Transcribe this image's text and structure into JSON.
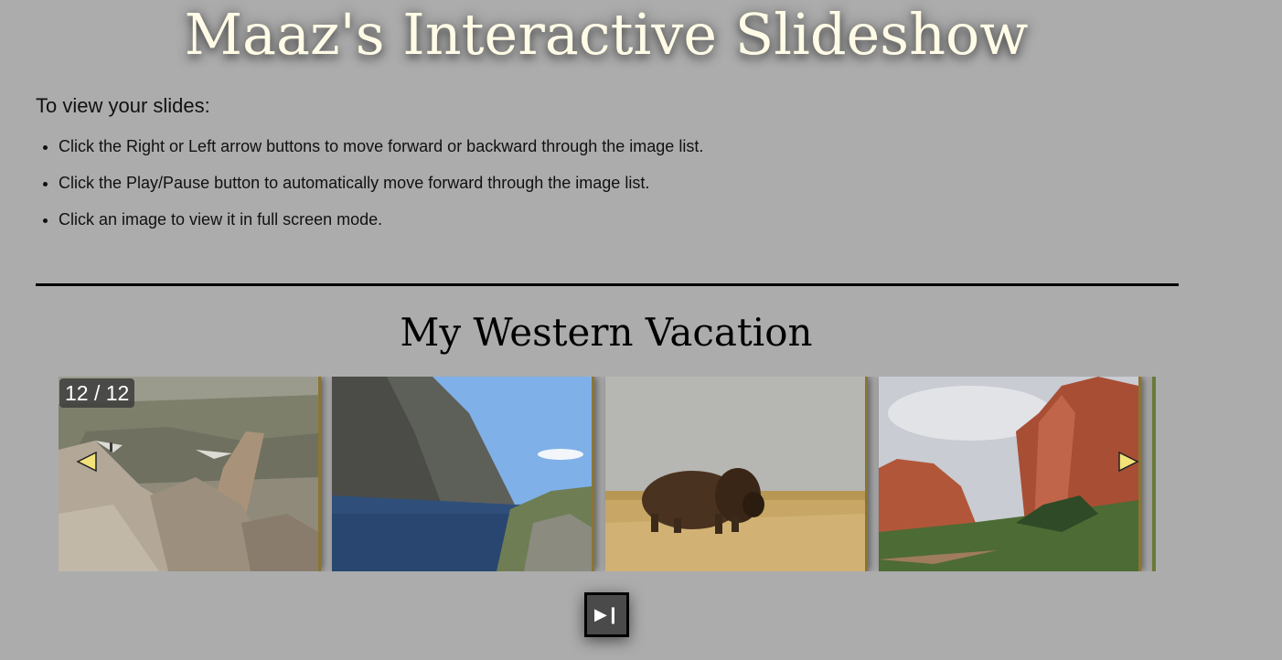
{
  "header": {
    "title": "Maaz's Interactive Slideshow"
  },
  "intro": {
    "text": "To view your slides:",
    "instructions": [
      "Click the Right or Left arrow buttons to move forward or backward through the image list.",
      "Click the Play/Pause button to automatically move forward through the image list.",
      "Click an image to view it in full screen mode."
    ]
  },
  "gallery": {
    "title": "My Western Vacation",
    "counter": "12 / 12",
    "prev_icon": "left-triangle-arrow-icon",
    "next_icon": "right-triangle-arrow-icon",
    "slides": [
      {
        "name": "rocky-cliff-slide"
      },
      {
        "name": "mountain-lake-slide"
      },
      {
        "name": "bison-prairie-slide"
      },
      {
        "name": "red-rock-formation-slide"
      }
    ],
    "play_pause_icon": "play-pause-icon",
    "play_pause_glyph": "▶❙"
  },
  "colors": {
    "background": "#acacac",
    "title_text": "#fffbe6",
    "arrow_fill": "#f2e27a",
    "slide_border": "#8a7535",
    "button_bg": "#4a4a4a"
  }
}
